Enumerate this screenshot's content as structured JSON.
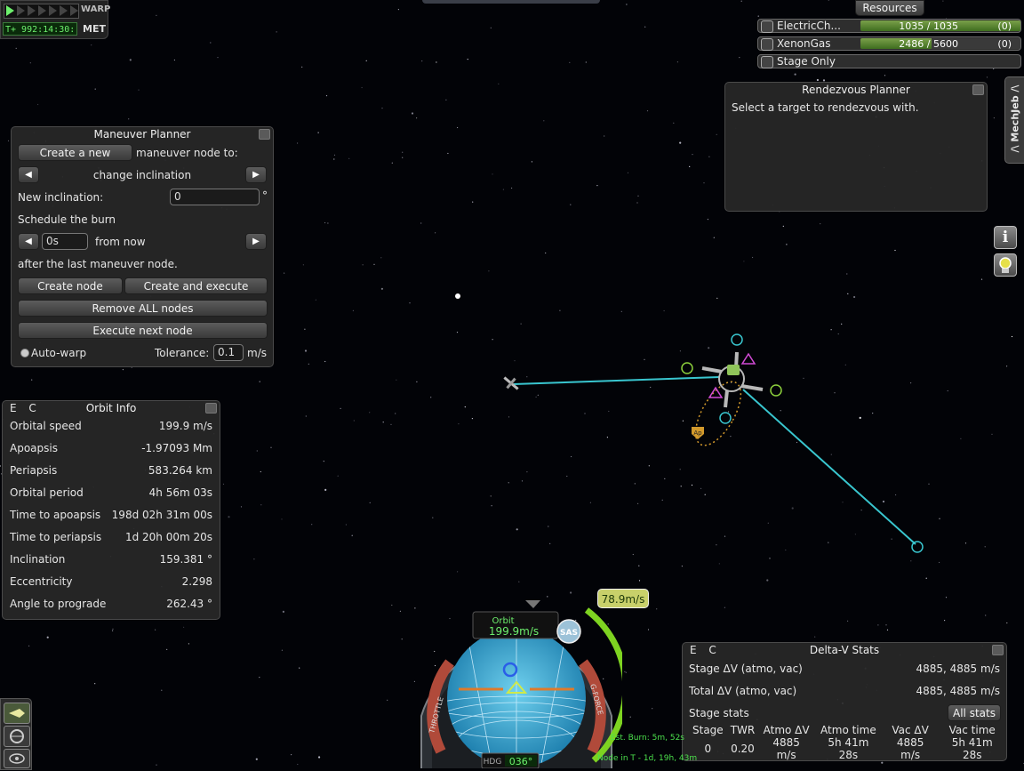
{
  "colors": {
    "orbit_line": "#39c6cf",
    "apsis_orange": "#d39a2c",
    "ec_green": "#6a9a3a",
    "throttle_green": "#7ed321",
    "velocity_green": "#7ed321"
  },
  "warp": {
    "label": "WARP",
    "met_label": "MET",
    "met_value": "T+ 992:14:30:",
    "arrows": 7
  },
  "resources": {
    "button": "Resources",
    "items": [
      {
        "name": "ElectricCh...",
        "amount": "1035",
        "max": "1035",
        "rate": "(0)",
        "fill": 1.0
      },
      {
        "name": "XenonGas",
        "amount": "2486",
        "max": "5600",
        "rate": "(0)",
        "fill": 0.444
      }
    ],
    "stage_only": "Stage Only"
  },
  "maneuver": {
    "title": "Maneuver Planner",
    "create_new": "Create a new",
    "node_to": "maneuver node to:",
    "operation": "change inclination",
    "new_inclination_label": "New inclination:",
    "new_inclination_value": "0",
    "degree": "°",
    "schedule": "Schedule the burn",
    "time_value": "0s",
    "from_now": "from now",
    "after_last": "after the last maneuver node.",
    "create_node": "Create node",
    "create_execute": "Create and execute",
    "remove_all": "Remove ALL nodes",
    "execute_next": "Execute next node",
    "auto_warp": "Auto-warp",
    "tolerance_label": "Tolerance:",
    "tolerance_value": "0.1",
    "tolerance_unit": "m/s"
  },
  "rendezvous": {
    "title": "Rendezvous Planner",
    "message": "Select a target to rendezvous with."
  },
  "mechjeb_tab": "/\\ MechJeb /\\",
  "orbit_info": {
    "ec": "E C",
    "title": "Orbit Info",
    "rows": [
      {
        "k": "Orbital speed",
        "v": "199.9 m/s"
      },
      {
        "k": "Apoapsis",
        "v": "-1.97093 Mm"
      },
      {
        "k": "Periapsis",
        "v": "583.264 km"
      },
      {
        "k": "Orbital period",
        "v": "4h 56m 03s"
      },
      {
        "k": "Time to apoapsis",
        "v": "198d 02h 31m 00s"
      },
      {
        "k": "Time to periapsis",
        "v": "1d 20h 00m 20s"
      },
      {
        "k": "Inclination",
        "v": "159.381 °"
      },
      {
        "k": "Eccentricity",
        "v": "2.298"
      },
      {
        "k": "Angle to prograde",
        "v": "262.43 °"
      }
    ]
  },
  "deltav": {
    "ec": "E C",
    "title": "Delta-V Stats",
    "stage_dv_label": "Stage ΔV (atmo, vac)",
    "stage_dv_value": "4885, 4885 m/s",
    "total_dv_label": "Total ΔV (atmo, vac)",
    "total_dv_value": "4885, 4885 m/s",
    "stage_stats": "Stage stats",
    "all_stats": "All stats",
    "headers": [
      "Stage",
      "TWR",
      "Atmo ΔV",
      "Atmo time",
      "Vac ΔV",
      "Vac time"
    ],
    "row": [
      "0",
      "0.20",
      "4885 m/s",
      "5h 41m 28s",
      "4885 m/s",
      "5h 41m 28s"
    ]
  },
  "navball": {
    "mode": "Orbit",
    "speed": "199.9m/s",
    "sas": "SAS",
    "hdg_label": "HDG",
    "heading": "036°",
    "throttle_label": "THROTTLE",
    "gforce_label": "G-FORCE",
    "velocity_tag": "78.9m/s",
    "est_burn": "Est. Burn: 5m, 52s",
    "node_in": "Node in T - 1d, 19h, 43m",
    "throttle_fraction": 0.0
  },
  "map": {
    "ap_label": "Ap"
  }
}
